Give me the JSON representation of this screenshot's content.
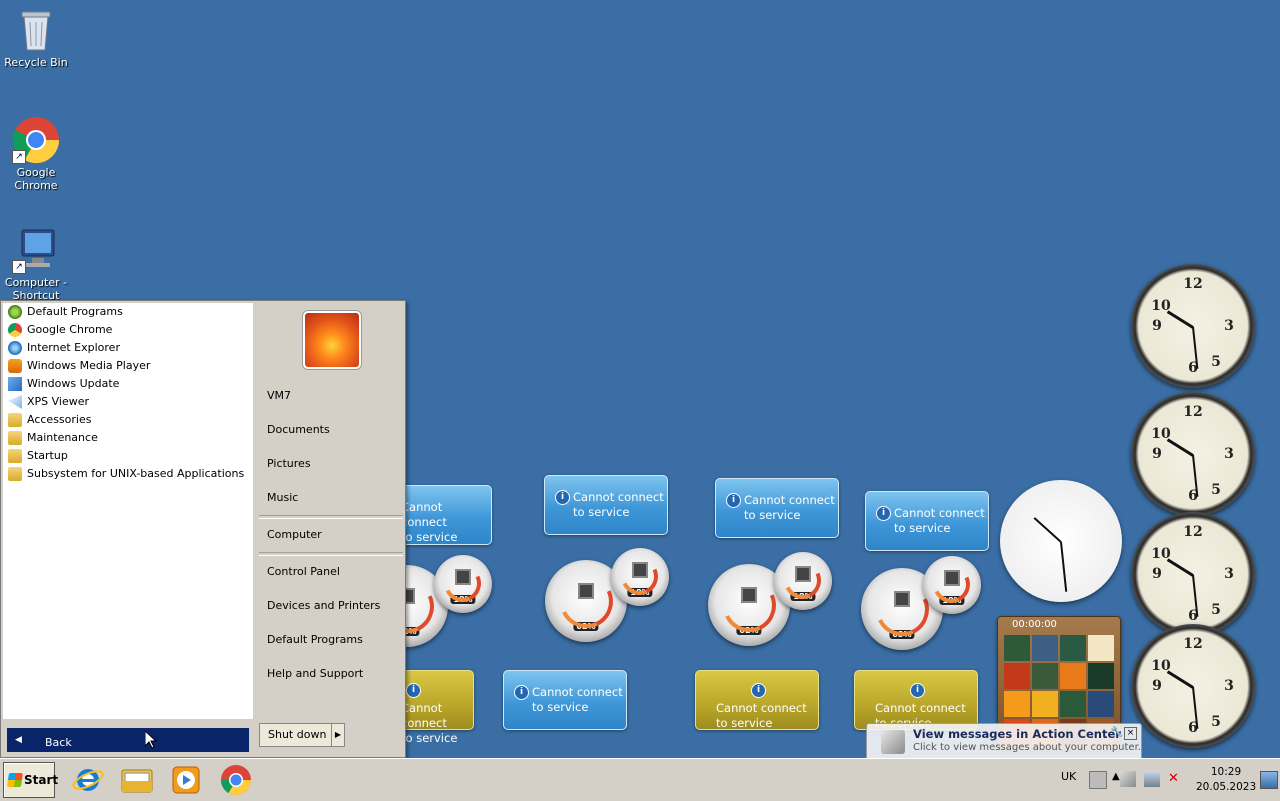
{
  "desktop": {
    "icons": [
      {
        "label": "Recycle Bin",
        "icon": "recycle-bin-icon"
      },
      {
        "label": "Google\nChrome",
        "icon": "chrome-icon"
      },
      {
        "label": "Computer -\nShortcut",
        "icon": "computer-icon"
      }
    ]
  },
  "gadgets": {
    "weather_text_line1": "Cannot connect",
    "weather_text_line2": "to service",
    "meters": [
      {
        "cpu": "02%",
        "mem": "18%"
      },
      {
        "cpu": "02%",
        "mem": "18%"
      },
      {
        "cpu": "02%",
        "mem": "18%"
      },
      {
        "cpu": "03%",
        "mem": "18%"
      }
    ],
    "puzzle_timer": "00:00:00"
  },
  "start_menu": {
    "programs": [
      {
        "label": "Default Programs",
        "icon": "default-programs-icon"
      },
      {
        "label": "Google Chrome",
        "icon": "chrome-icon"
      },
      {
        "label": "Internet Explorer",
        "icon": "ie-icon"
      },
      {
        "label": "Windows Media Player",
        "icon": "media-player-icon"
      },
      {
        "label": "Windows Update",
        "icon": "windows-update-icon"
      },
      {
        "label": "XPS Viewer",
        "icon": "xps-viewer-icon"
      },
      {
        "label": "Accessories",
        "icon": "folder-icon"
      },
      {
        "label": "Maintenance",
        "icon": "folder-icon"
      },
      {
        "label": "Startup",
        "icon": "folder-icon"
      },
      {
        "label": "Subsystem for UNIX-based Applications",
        "icon": "folder-icon"
      }
    ],
    "back_label": "Back",
    "right_items": {
      "user": "VM7",
      "documents": "Documents",
      "pictures": "Pictures",
      "music": "Music",
      "computer": "Computer",
      "control_panel": "Control Panel",
      "devices": "Devices and Printers",
      "default_programs": "Default Programs",
      "help": "Help and Support"
    },
    "shutdown_label": "Shut down"
  },
  "balloon": {
    "title": "View messages in Action Center",
    "subtitle": "Click to view messages about your computer."
  },
  "taskbar": {
    "start_label": "Start",
    "pinned": [
      "internet-explorer-icon",
      "explorer-icon",
      "media-player-icon",
      "chrome-icon"
    ],
    "language": "UK",
    "time": "10:29",
    "date": "20.05.2023"
  },
  "colors": {
    "desktop": "#3a6ea5",
    "selection": "#0a246a",
    "chrome": "#d4d0c8"
  }
}
